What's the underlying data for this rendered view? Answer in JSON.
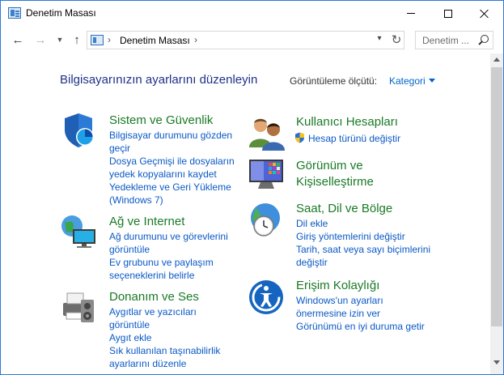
{
  "window": {
    "title": "Denetim Masası"
  },
  "nav": {
    "back_glyph": "←",
    "forward_glyph": "→",
    "recent_glyph": "▼",
    "up_glyph": "↑",
    "address_sep": "›",
    "address_text": "Denetim Masası",
    "address_dropdown_glyph": "▾",
    "refresh_glyph": "↻",
    "search_placeholder": "Denetim ..."
  },
  "header": {
    "title": "Bilgisayarınızın ayarlarını düzenleyin",
    "view_label": "Görüntüleme ölçütü:",
    "view_value": "Kategori"
  },
  "categories": [
    {
      "title": "Sistem ve Güvenlik",
      "icon": "shield-icon",
      "links": [
        "Bilgisayar durumunu gözden",
        "geçir",
        "Dosya Geçmişi ile dosyaların",
        "yedek kopyalarını kaydet",
        "Yedekleme ve Geri Yükleme",
        "(Windows 7)"
      ]
    },
    {
      "title": "Ağ ve Internet",
      "icon": "network-icon",
      "links": [
        "Ağ durumunu ve görevlerini",
        "görüntüle",
        "Ev grubunu ve paylaşım",
        "seçeneklerini belirle"
      ]
    },
    {
      "title": "Donanım ve Ses",
      "icon": "printer-icon",
      "links": [
        "Aygıtlar ve yazıcıları",
        "görüntüle",
        "Aygıt ekle",
        "Sık kullanılan taşınabilirlik",
        "ayarlarını düzenle"
      ]
    },
    {
      "title": "Kullanıcı Hesapları",
      "icon": "users-icon",
      "links": [
        "Hesap türünü değiştir"
      ]
    },
    {
      "title_line1": "Görünüm ve",
      "title_line2": "Kişiselleştirme",
      "icon": "appearance-icon",
      "links": []
    },
    {
      "title": "Saat, Dil ve Bölge",
      "icon": "clock-globe-icon",
      "links": [
        "Dil ekle",
        "Giriş yöntemlerini değiştir",
        "Tarih, saat veya sayı biçimlerini",
        "değiştir"
      ]
    },
    {
      "title": "Erişim Kolaylığı",
      "icon": "accessibility-icon",
      "links": [
        "Windows'un ayarları",
        "önermesine izin ver",
        "Görünümü en iyi duruma getir"
      ]
    }
  ],
  "colors": {
    "title_blue": "#1e3287",
    "category_green": "#1a7a26",
    "link_blue": "#0a59c6",
    "accent": "#0066cc"
  }
}
